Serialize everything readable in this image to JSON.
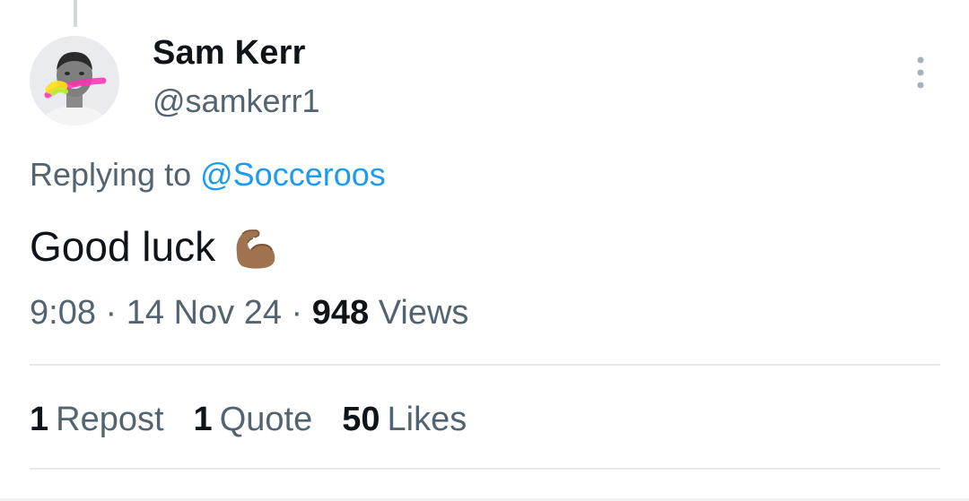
{
  "tweet": {
    "author_name": "Sam Kerr",
    "author_handle": "@samkerr1",
    "replying_prefix": "Replying to ",
    "replying_to": "@Socceroos",
    "text": "Good luck",
    "emoji": "flexed-biceps-emoji",
    "time": "9:08",
    "date": "14 Nov 24",
    "separator": "·",
    "views_count": "948",
    "views_label": "Views"
  },
  "stats": {
    "reposts_count": "1",
    "reposts_label": "Repost",
    "quotes_count": "1",
    "quotes_label": "Quote",
    "likes_count": "50",
    "likes_label": "Likes"
  },
  "icons": {
    "more": "more-vertical-icon"
  },
  "colors": {
    "link": "#1d9bf0",
    "secondary_text": "#536471",
    "primary_text": "#0f1419"
  }
}
